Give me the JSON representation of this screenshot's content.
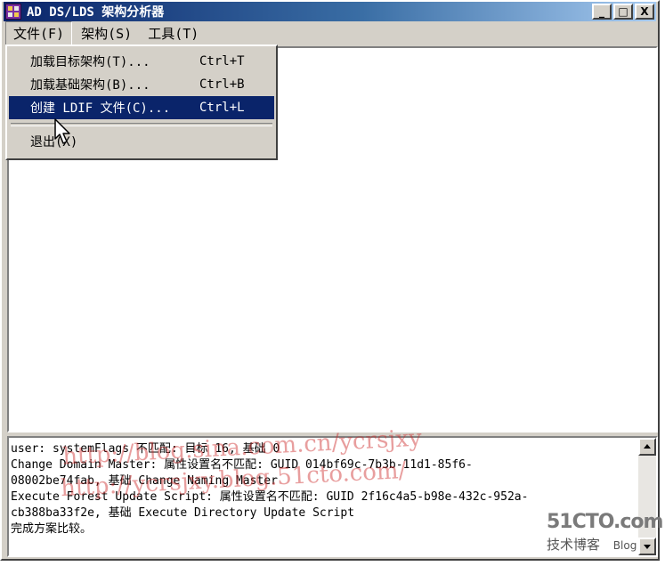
{
  "window": {
    "title": "AD DS/LDS 架构分析器",
    "buttons": {
      "minimize": "_",
      "maximize": "□",
      "close": "X"
    }
  },
  "menubar": [
    {
      "label": "文件(F)"
    },
    {
      "label": "架构(S)"
    },
    {
      "label": "工具(T)"
    }
  ],
  "file_menu": {
    "items": [
      {
        "label": "加载目标架构(T)...",
        "shortcut": "Ctrl+T"
      },
      {
        "label": "加载基础架构(B)...",
        "shortcut": "Ctrl+B"
      },
      {
        "label": "创建 LDIF 文件(C)...",
        "shortcut": "Ctrl+L"
      },
      {
        "label": "退出(X)",
        "shortcut": ""
      }
    ],
    "highlighted_index": 2
  },
  "log": {
    "lines": [
      "user: systemFlags 不匹配: 目标 16, 基础 0",
      "Change Domain Master: 属性设置名不匹配: GUID 014bf69c-7b3b-11d1-85f6-",
      "08002be74fab, 基础 Change Naming Master",
      "Execute Forest Update Script: 属性设置名不匹配: GUID 2f16c4a5-b98e-432c-952a-",
      "cb388ba33f2e, 基础 Execute Directory Update Script",
      "完成方案比较。"
    ]
  },
  "watermarks": {
    "line1": "http://blog.sina.com.cn/ycrsjxy",
    "line2": "http://ycrsjxy.blog.51cto.com/"
  },
  "brand": {
    "name": "51CTO.com",
    "sub": "技术博客",
    "blog": "Blog"
  },
  "colors": {
    "title_bar": "#0a246a",
    "highlight": "#0a246a",
    "watermark": "#cd2828",
    "face": "#d4d0c8"
  },
  "icons": {
    "app": "schema-analyzer-icon",
    "cursor": "arrow-cursor"
  }
}
